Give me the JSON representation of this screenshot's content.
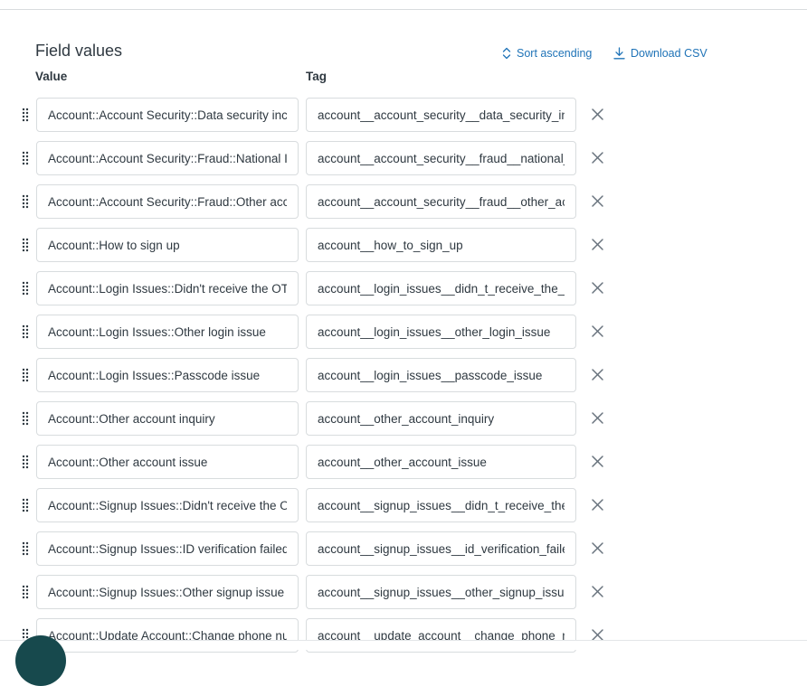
{
  "section": {
    "title": "Field values",
    "sort_label": "Sort ascending",
    "download_label": "Download CSV"
  },
  "columns": {
    "value": "Value",
    "tag": "Tag"
  },
  "rows": [
    {
      "value": "Account::Account Security::Data security incident",
      "tag": "account__account_security__data_security_incident"
    },
    {
      "value": "Account::Account Security::Fraud::National ID misuse",
      "tag": "account__account_security__fraud__national_id_misuse"
    },
    {
      "value": "Account::Account Security::Fraud::Other account fraud",
      "tag": "account__account_security__fraud__other_account_fraud"
    },
    {
      "value": "Account::How to sign up",
      "tag": "account__how_to_sign_up"
    },
    {
      "value": "Account::Login Issues::Didn't receive the OTP",
      "tag": "account__login_issues__didn_t_receive_the_otp"
    },
    {
      "value": "Account::Login Issues::Other login issue",
      "tag": "account__login_issues__other_login_issue"
    },
    {
      "value": "Account::Login Issues::Passcode issue",
      "tag": "account__login_issues__passcode_issue"
    },
    {
      "value": "Account::Other account inquiry",
      "tag": "account__other_account_inquiry"
    },
    {
      "value": "Account::Other account issue",
      "tag": "account__other_account_issue"
    },
    {
      "value": "Account::Signup Issues::Didn't receive the OTP",
      "tag": "account__signup_issues__didn_t_receive_the_otp"
    },
    {
      "value": "Account::Signup Issues::ID verification failed",
      "tag": "account__signup_issues__id_verification_failed"
    },
    {
      "value": "Account::Signup Issues::Other signup issue",
      "tag": "account__signup_issues__other_signup_issue"
    },
    {
      "value": "Account::Update Account::Change phone number",
      "tag": "account__update_account__change_phone_number"
    }
  ],
  "colors": {
    "accent": "#1f73b7",
    "text": "#2f3941",
    "border": "#d8dcde",
    "icon": "#68737d",
    "fab": "#17494d"
  },
  "icons": {
    "sort": "sort-icon",
    "download": "download-icon",
    "drag": "drag-handle-icon",
    "remove": "close-icon"
  }
}
